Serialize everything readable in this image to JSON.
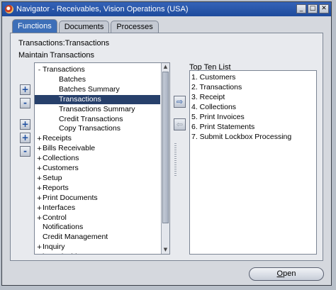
{
  "window": {
    "title": "Navigator - Receivables, Vision Operations (USA)",
    "controls": [
      "minimize",
      "maximize",
      "close"
    ]
  },
  "tabs": [
    {
      "label": "Functions",
      "active": true
    },
    {
      "label": "Documents",
      "active": false
    },
    {
      "label": "Processes",
      "active": false
    }
  ],
  "path": "Transactions:Transactions",
  "section_label": "Maintain Transactions",
  "tree": {
    "items": [
      {
        "label": "Transactions",
        "expander": "-",
        "indent": 0,
        "selected": false
      },
      {
        "label": "Batches",
        "expander": "",
        "indent": 1,
        "selected": false
      },
      {
        "label": "Batches Summary",
        "expander": "",
        "indent": 1,
        "selected": false
      },
      {
        "label": "Transactions",
        "expander": "",
        "indent": 1,
        "selected": true
      },
      {
        "label": "Transactions Summary",
        "expander": "",
        "indent": 1,
        "selected": false
      },
      {
        "label": "Credit Transactions",
        "expander": "",
        "indent": 1,
        "selected": false
      },
      {
        "label": "Copy Transactions",
        "expander": "",
        "indent": 1,
        "selected": false
      },
      {
        "label": "Receipts",
        "expander": "+",
        "indent": 0,
        "selected": false
      },
      {
        "label": "Bills Receivable",
        "expander": "+",
        "indent": 0,
        "selected": false
      },
      {
        "label": "Collections",
        "expander": "+",
        "indent": 0,
        "selected": false
      },
      {
        "label": "Customers",
        "expander": "+",
        "indent": 0,
        "selected": false
      },
      {
        "label": "Setup",
        "expander": "+",
        "indent": 0,
        "selected": false
      },
      {
        "label": "Reports",
        "expander": "+",
        "indent": 0,
        "selected": false
      },
      {
        "label": "Print Documents",
        "expander": "+",
        "indent": 0,
        "selected": false
      },
      {
        "label": "Interfaces",
        "expander": "+",
        "indent": 0,
        "selected": false
      },
      {
        "label": "Control",
        "expander": "+",
        "indent": 0,
        "selected": false
      },
      {
        "label": "Notifications",
        "expander": "",
        "indent": 0,
        "selected": false
      },
      {
        "label": "Credit Management",
        "expander": "",
        "indent": 0,
        "selected": false
      },
      {
        "label": "Inquiry",
        "expander": "+",
        "indent": 0,
        "selected": false
      },
      {
        "label": "iReceivables",
        "expander": "",
        "indent": 0,
        "selected": false
      }
    ]
  },
  "side_buttons": {
    "expand": "+",
    "collapse": "-",
    "expand_branch": "+",
    "expand_all": "+",
    "collapse_all": "-"
  },
  "transfer": {
    "add": "⇨",
    "remove": "⇦"
  },
  "topten": {
    "label": "Top Ten List",
    "items": [
      "1. Customers",
      "2. Transactions",
      "3. Receipt",
      "4. Collections",
      "5. Print Invoices",
      "6. Print Statements",
      "7. Submit Lockbox Processing"
    ]
  },
  "open_button": {
    "first": "O",
    "rest": "pen"
  }
}
